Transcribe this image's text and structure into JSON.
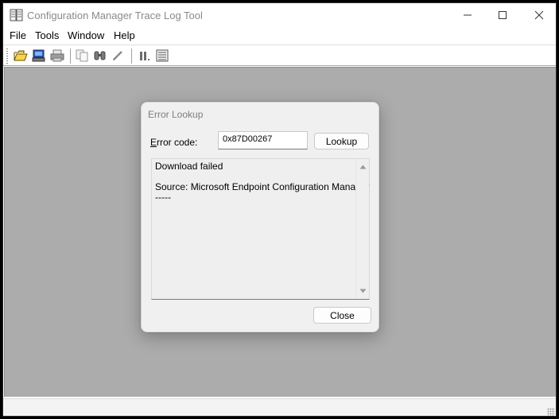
{
  "window": {
    "title": "Configuration Manager Trace Log Tool",
    "controls": [
      "minimize",
      "maximize",
      "close"
    ]
  },
  "menu": {
    "items": [
      {
        "label": "File"
      },
      {
        "label": "Tools"
      },
      {
        "label": "Window"
      },
      {
        "label": "Help"
      }
    ]
  },
  "toolbar": {
    "buttons": [
      {
        "icon": "open-folder-icon"
      },
      {
        "icon": "computer-icon"
      },
      {
        "icon": "print-icon"
      },
      {
        "icon": "copy-icon"
      },
      {
        "icon": "find-binoculars-icon"
      },
      {
        "icon": "highlight-icon"
      },
      {
        "icon": "pause-icon"
      },
      {
        "icon": "log-details-icon"
      }
    ]
  },
  "dialog": {
    "title": "Error Lookup",
    "error_code_label_mnemonic": "E",
    "error_code_label_rest": "rror code:",
    "error_code_value": "0x87D00267",
    "lookup_button": "Lookup",
    "result_lines": [
      "Download failed",
      "",
      "Source: Microsoft Endpoint Configuration Manager",
      "-----"
    ],
    "close_button": "Close"
  },
  "colors": {
    "client_background": "#acacac",
    "dialog_background": "#f0f0f0",
    "title_text": "#8a8a8a"
  }
}
